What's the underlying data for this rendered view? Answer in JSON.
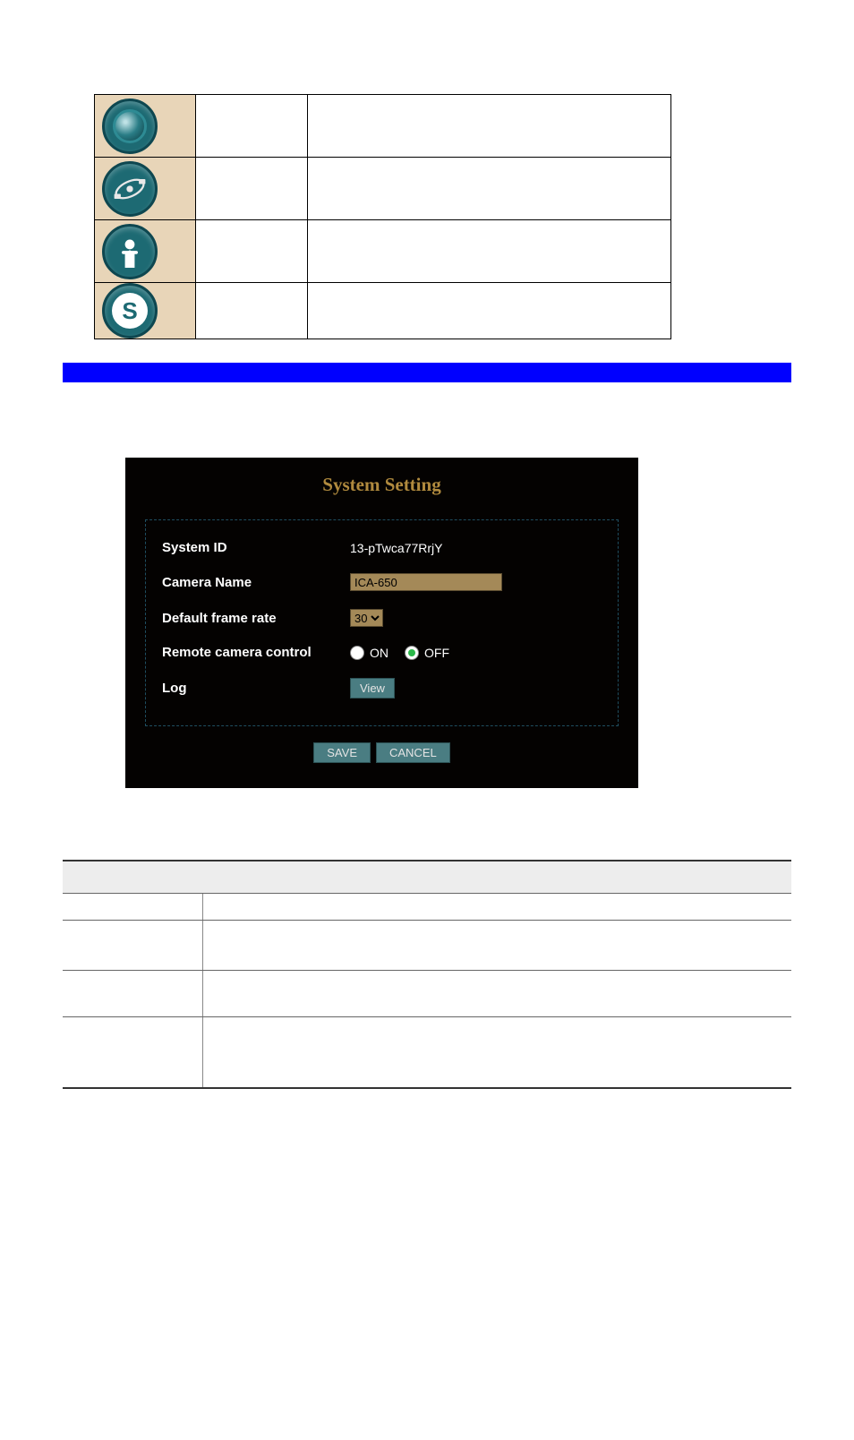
{
  "icon_rows": [
    {
      "name": "camera",
      "label": "",
      "desc": ""
    },
    {
      "name": "network",
      "label": "",
      "desc": ""
    },
    {
      "name": "user",
      "label": "",
      "desc": ""
    },
    {
      "name": "system",
      "label": "",
      "desc": ""
    }
  ],
  "panel": {
    "title": "System Setting",
    "rows": {
      "system_id": {
        "label": "System ID",
        "value": "13-pTwca77RrjY"
      },
      "camera_name": {
        "label": "Camera Name",
        "value": "ICA-650"
      },
      "frame_rate": {
        "label": "Default frame rate",
        "value": "30"
      },
      "remote_control": {
        "label": "Remote camera control",
        "on": "ON",
        "off": "OFF",
        "selected": "OFF"
      },
      "log": {
        "label": "Log",
        "button": "View"
      }
    },
    "actions": {
      "save": "SAVE",
      "cancel": "CANCEL"
    }
  },
  "desc_table": {
    "header": {
      "param": "",
      "desc": ""
    },
    "rows": [
      {
        "param": "",
        "desc": ""
      },
      {
        "param": "",
        "desc": ""
      },
      {
        "param": "",
        "desc": ""
      },
      {
        "param": "",
        "desc": ""
      }
    ]
  }
}
